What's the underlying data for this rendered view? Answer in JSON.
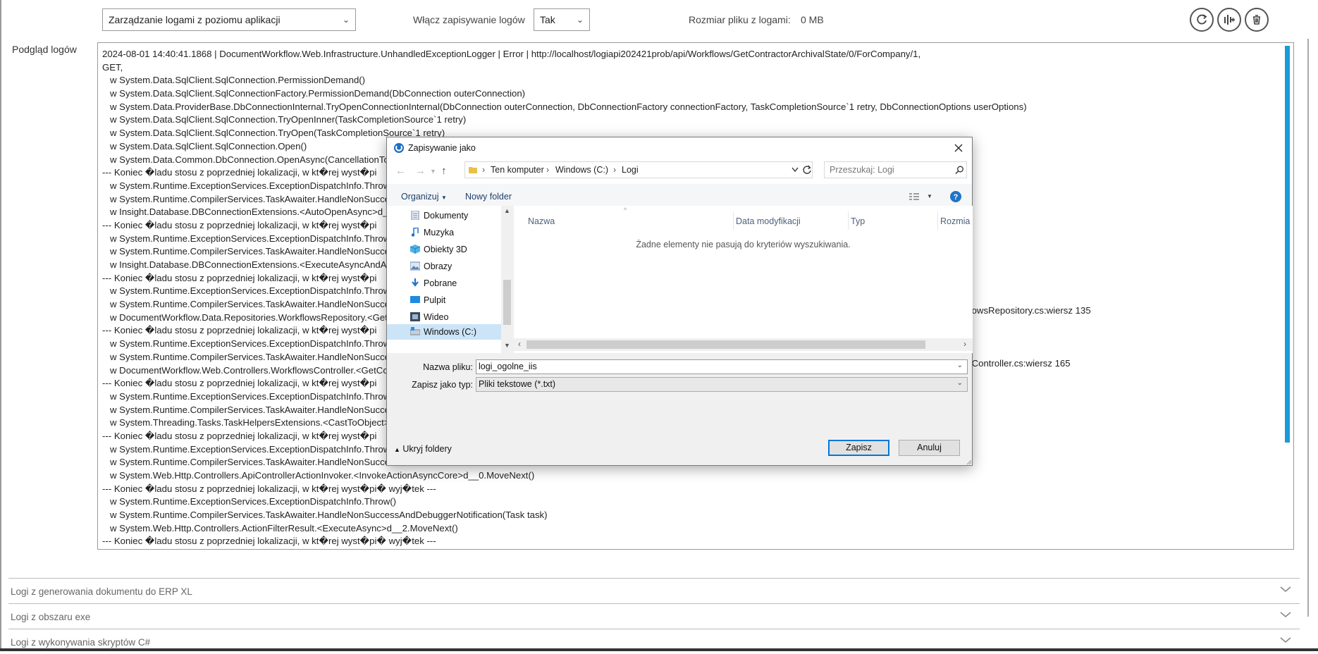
{
  "header": {
    "mode_select": "Zarządzanie logami z poziomu aplikacji",
    "enable_label": "Włącz zapisywanie logów",
    "enable_value": "Tak",
    "size_label": "Rozmiar pliku z logami:",
    "size_value": "0 MB",
    "buttons": [
      "refresh-icon",
      "download-icon",
      "trash-icon"
    ]
  },
  "log": {
    "label": "Podgląd logów",
    "lines": [
      "2024-08-01 14:40:41.1868 | DocumentWorkflow.Web.Infrastructure.UnhandledExceptionLogger | Error | http://localhost/logiapi202421prob/api/Workflows/GetContractorArchivalState/0/ForCompany/1,",
      "GET,",
      "   w System.Data.SqlClient.SqlConnection.PermissionDemand()",
      "   w System.Data.SqlClient.SqlConnectionFactory.PermissionDemand(DbConnection outerConnection)",
      "   w System.Data.ProviderBase.DbConnectionInternal.TryOpenConnectionInternal(DbConnection outerConnection, DbConnectionFactory connectionFactory, TaskCompletionSource`1 retry, DbConnectionOptions userOptions)",
      "   w System.Data.SqlClient.SqlConnection.TryOpenInner(TaskCompletionSource`1 retry)",
      "   w System.Data.SqlClient.SqlConnection.TryOpen(TaskCompletionSource`1 retry)",
      "   w System.Data.SqlClient.SqlConnection.Open()",
      "   w System.Data.Common.DbConnection.OpenAsync(CancellationToke",
      "--- Koniec �ladu stosu z poprzedniej lokalizacji, w kt�rej wyst�pi",
      "   w System.Runtime.ExceptionServices.ExceptionDispatchInfo.Throw()",
      "   w System.Runtime.CompilerServices.TaskAwaiter.HandleNonSuccess",
      "   w Insight.Database.DBConnectionExtensions.<AutoOpenAsync>d__3",
      "--- Koniec �ladu stosu z poprzedniej lokalizacji, w kt�rej wyst�pi",
      "   w System.Runtime.ExceptionServices.ExceptionDispatchInfo.Throw()",
      "   w System.Runtime.CompilerServices.TaskAwaiter.HandleNonSuccess",
      "   w Insight.Database.DBConnectionExtensions.<ExecuteAsyncAndAuto",
      "--- Koniec �ladu stosu z poprzedniej lokalizacji, w kt�rej wyst�pi",
      "   w System.Runtime.ExceptionServices.ExceptionDispatchInfo.Throw()",
      "   w System.Runtime.CompilerServices.TaskAwaiter.HandleNonSuccess",
      "   w DocumentWorkflow.Data.Repositories.WorkflowsRepository.<Get",
      "--- Koniec �ladu stosu z poprzedniej lokalizacji, w kt�rej wyst�pi",
      "   w System.Runtime.ExceptionServices.ExceptionDispatchInfo.Throw()",
      "   w System.Runtime.CompilerServices.TaskAwaiter.HandleNonSuccess",
      "   w DocumentWorkflow.Web.Controllers.WorkflowsController.<GetCo",
      "--- Koniec �ladu stosu z poprzedniej lokalizacji, w kt�rej wyst�pi",
      "   w System.Runtime.ExceptionServices.ExceptionDispatchInfo.Throw()",
      "   w System.Runtime.CompilerServices.TaskAwaiter.HandleNonSuccess",
      "   w System.Threading.Tasks.TaskHelpersExtensions.<CastToObject>d_",
      "--- Koniec �ladu stosu z poprzedniej lokalizacji, w kt�rej wyst�pi",
      "   w System.Runtime.ExceptionServices.ExceptionDispatchInfo.Throw()",
      "   w System.Runtime.CompilerServices.TaskAwaiter.HandleNonSuccess",
      "   w System.Web.Http.Controllers.ApiControllerActionInvoker.<InvokeActionAsyncCore>d__0.MoveNext()",
      "--- Koniec �ladu stosu z poprzedniej lokalizacji, w kt�rej wyst�pi� wyj�tek ---",
      "   w System.Runtime.ExceptionServices.ExceptionDispatchInfo.Throw()",
      "   w System.Runtime.CompilerServices.TaskAwaiter.HandleNonSuccessAndDebuggerNotification(Task task)",
      "   w System.Web.Http.Controllers.ActionFilterResult.<ExecuteAsync>d__2.MoveNext()",
      "--- Koniec �ladu stosu z poprzedniej lokalizacji, w kt�rej wyst�pi� wyj�tek ---"
    ],
    "overflow_fragments": [
      {
        "line": 20,
        "text": "flowsRepository.cs:wiersz 135"
      },
      {
        "line": 24,
        "text": "sController.cs:wiersz 165"
      }
    ]
  },
  "sections": [
    "Logi z generowania dokumentu do ERP XL",
    "Logi z obszaru exe",
    "Logi z wykonywania skryptów C#"
  ],
  "dialog": {
    "title": "Zapisywanie jako",
    "breadcrumb": [
      "Ten komputer",
      "Windows (C:)",
      "Logi"
    ],
    "search_placeholder": "Przeszukaj: Logi",
    "toolbar": {
      "organize": "Organizuj",
      "new_folder": "Nowy folder"
    },
    "nav_items": [
      "Dokumenty",
      "Muzyka",
      "Obiekty 3D",
      "Obrazy",
      "Pobrane",
      "Pulpit",
      "Wideo",
      "Windows (C:)"
    ],
    "nav_selected": "Windows (C:)",
    "columns": [
      "Nazwa",
      "Data modyfikacji",
      "Typ",
      "Rozmia"
    ],
    "empty_message": "Żadne elementy nie pasują do kryteriów wyszukiwania.",
    "filename_label": "Nazwa pliku:",
    "filename_value": "logi_ogolne_iis",
    "filetype_label": "Zapisz jako typ:",
    "filetype_value": "Pliki tekstowe (*.txt)",
    "hide_folders": "Ukryj foldery",
    "save_button": "Zapisz",
    "cancel_button": "Anuluj"
  },
  "colors": {
    "accent_blue": "#1c9ad6",
    "selection": "#cce4f7",
    "primary_border": "#0078d7"
  }
}
